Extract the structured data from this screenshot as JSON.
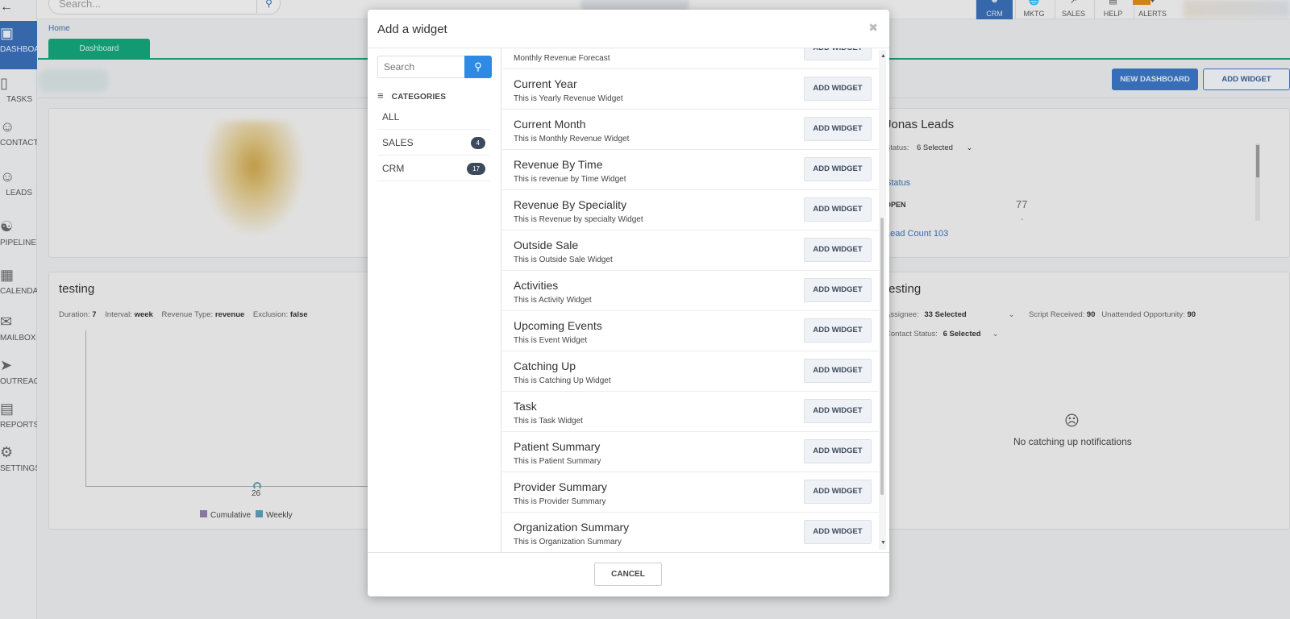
{
  "top_search": {
    "placeholder": "Search..."
  },
  "top_nav": [
    {
      "label": "CRM",
      "icon": "user-icon",
      "active": true
    },
    {
      "label": "MKTG",
      "icon": "globe-icon"
    },
    {
      "label": "SALES",
      "icon": "chart-icon"
    },
    {
      "label": "HELP",
      "icon": "book-icon"
    },
    {
      "label": "ALERTS",
      "icon": "bell-icon"
    }
  ],
  "sidebar": {
    "items": [
      {
        "label": "DASHBOARD",
        "icon": "monitor-icon",
        "active": true
      },
      {
        "label": "TASKS",
        "icon": "notebook-icon"
      },
      {
        "label": "CONTACTS",
        "icon": "contacts-icon"
      },
      {
        "label": "LEADS",
        "icon": "users-icon"
      },
      {
        "label": "PIPELINE",
        "icon": "pipeline-icon"
      },
      {
        "label": "CALENDAR",
        "icon": "calendar-icon"
      },
      {
        "label": "MAILBOX",
        "icon": "mail-icon"
      },
      {
        "label": "OUTREACH",
        "icon": "send-icon"
      },
      {
        "label": "REPORTS",
        "icon": "reports-icon"
      },
      {
        "label": "SETTINGS",
        "icon": "gear-icon"
      }
    ]
  },
  "breadcrumb": "Home",
  "dashboard_tab": "Dashboard",
  "actions": {
    "new_dashboard": "NEW DASHBOARD",
    "add_widget": "ADD WIDGET"
  },
  "testing_card": {
    "title": "testing",
    "filters": [
      {
        "k": "Duration:",
        "v": "7"
      },
      {
        "k": "Interval:",
        "v": "week"
      },
      {
        "k": "Revenue Type:",
        "v": "revenue"
      },
      {
        "k": "Exclusion:",
        "v": "false"
      }
    ],
    "x_tick": "26",
    "legend": [
      {
        "name": "Cumulative",
        "color": "#8e7fa8"
      },
      {
        "name": "Weekly",
        "color": "#5c9bb8"
      }
    ]
  },
  "leads_card": {
    "title": "Jonas Leads",
    "status_label": "Status:",
    "status_value": "6 Selected",
    "status_link": "Status",
    "open_label": "OPEN",
    "open_value": "77",
    "dash": "-",
    "lead_count": "Lead Count 103"
  },
  "testing2_card": {
    "title": "testing",
    "assignee_label": "Assignee:",
    "assignee_value": "33 Selected",
    "script_label": "Script Received:",
    "script_value": "90",
    "unattended_label": "Unattended Opportunity:",
    "unattended_value": "90",
    "contact_label": "Contact Status:",
    "contact_value": "6 Selected",
    "empty": "No catching up notifications"
  },
  "modal": {
    "title": "Add a widget",
    "search_placeholder": "Search",
    "categories_label": "CATEGORIES",
    "categories": [
      {
        "label": "ALL"
      },
      {
        "label": "SALES",
        "count": "4"
      },
      {
        "label": "CRM",
        "count": "17"
      }
    ],
    "partial_item": "Monthly Revenue Forecast",
    "button_label": "ADD WIDGET",
    "widgets": [
      {
        "title": "Current Year",
        "desc": "This is Yearly Revenue Widget"
      },
      {
        "title": "Current Month",
        "desc": "This is Monthly Revenue Widget"
      },
      {
        "title": "Revenue By Time",
        "desc": "This is revenue by Time Widget"
      },
      {
        "title": "Revenue By Speciality",
        "desc": "This is Revenue by specialty Widget"
      },
      {
        "title": "Outside Sale",
        "desc": "This is Outside Sale Widget"
      },
      {
        "title": "Activities",
        "desc": "This is Activity Widget"
      },
      {
        "title": "Upcoming Events",
        "desc": "This is Event Widget"
      },
      {
        "title": "Catching Up",
        "desc": "This is Catching Up Widget"
      },
      {
        "title": "Task",
        "desc": "This is Task Widget"
      },
      {
        "title": "Patient Summary",
        "desc": "This is Patient Summary"
      },
      {
        "title": "Provider Summary",
        "desc": "This is Provider Summary"
      },
      {
        "title": "Organization Summary",
        "desc": "This is Organization Summary"
      }
    ],
    "cancel": "CANCEL"
  }
}
